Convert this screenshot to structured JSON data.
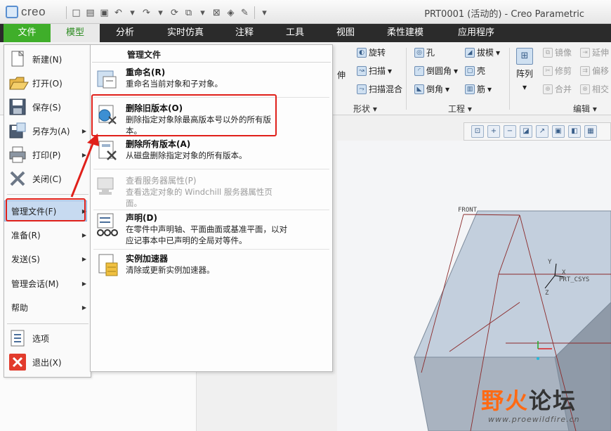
{
  "app": {
    "logo": "creo",
    "window_title": "PRT0001 (活动的) - Creo Parametric"
  },
  "tabs": [
    "文件",
    "模型",
    "分析",
    "实时仿真",
    "注释",
    "工具",
    "视图",
    "柔性建模",
    "应用程序"
  ],
  "ribbon": {
    "shape": {
      "revolve": "旋转",
      "sweep": "扫描",
      "swept_blend": "扫描混合",
      "extrude_partial": "伸",
      "group": "形状"
    },
    "engineering": {
      "hole": "孔",
      "draft": "拔模",
      "round": "倒圆角",
      "shell": "壳",
      "chamfer": "倒角",
      "rib": "筋",
      "group": "工程"
    },
    "editing": {
      "pattern": "阵列",
      "mirror": "镜像",
      "extend": "延伸",
      "trim": "修剪",
      "offset": "偏移",
      "merge": "合并",
      "intersect": "相交",
      "group": "编辑"
    }
  },
  "file_menu": [
    {
      "label": "新建(N)",
      "icon": "new-file-icon",
      "arrow": false
    },
    {
      "label": "打开(O)",
      "icon": "open-folder-icon",
      "arrow": false
    },
    {
      "label": "保存(S)",
      "icon": "save-icon",
      "arrow": false
    },
    {
      "label": "另存为(A)",
      "icon": "save-as-icon",
      "arrow": true
    },
    {
      "label": "打印(P)",
      "icon": "print-icon",
      "arrow": true
    },
    {
      "label": "关闭(C)",
      "icon": "close-icon",
      "arrow": false
    },
    {
      "label": "管理文件(F)",
      "arrow": true
    },
    {
      "label": "准备(R)",
      "arrow": true
    },
    {
      "label": "发送(S)",
      "arrow": true
    },
    {
      "label": "管理会话(M)",
      "arrow": true
    },
    {
      "label": "帮助",
      "arrow": true
    },
    {
      "label": "选项",
      "icon": "options-icon",
      "arrow": false
    },
    {
      "label": "退出(X)",
      "icon": "exit-icon",
      "arrow": false
    }
  ],
  "submenu": {
    "header": "管理文件",
    "items": [
      {
        "title": "重命名(R)",
        "desc": "重命名当前对象和子对象。",
        "disabled": false
      },
      {
        "title": "删除旧版本(O)",
        "desc": "删除指定对象除最高版本号以外的所有版本。",
        "disabled": false
      },
      {
        "title": "删除所有版本(A)",
        "desc": "从磁盘删除指定对象的所有版本。",
        "disabled": false
      },
      {
        "title": "查看服务器属性(P)",
        "desc": "查看选定对象的 Windchill 服务器属性页面。",
        "disabled": true
      },
      {
        "title": "声明(D)",
        "desc": "在零件中声明轴、平面曲面或基准平面，以对应记事本中已声明的全局对等件。",
        "disabled": false
      },
      {
        "title": "实例加速器",
        "desc": "清除或更新实例加速器。",
        "disabled": false
      }
    ]
  },
  "model": {
    "datum_front": "FRONT",
    "csys": "PRT_CSYS",
    "axis_x": "X",
    "axis_y": "Y",
    "axis_z": "Z"
  },
  "watermark": {
    "part_a": "野火",
    "part_b": "论坛",
    "url": "www.proewildfire.cn"
  },
  "colors": {
    "file_tab": "#3fae2a",
    "highlight_box": "#e0201a",
    "menu_hover": "#c7daf0"
  }
}
